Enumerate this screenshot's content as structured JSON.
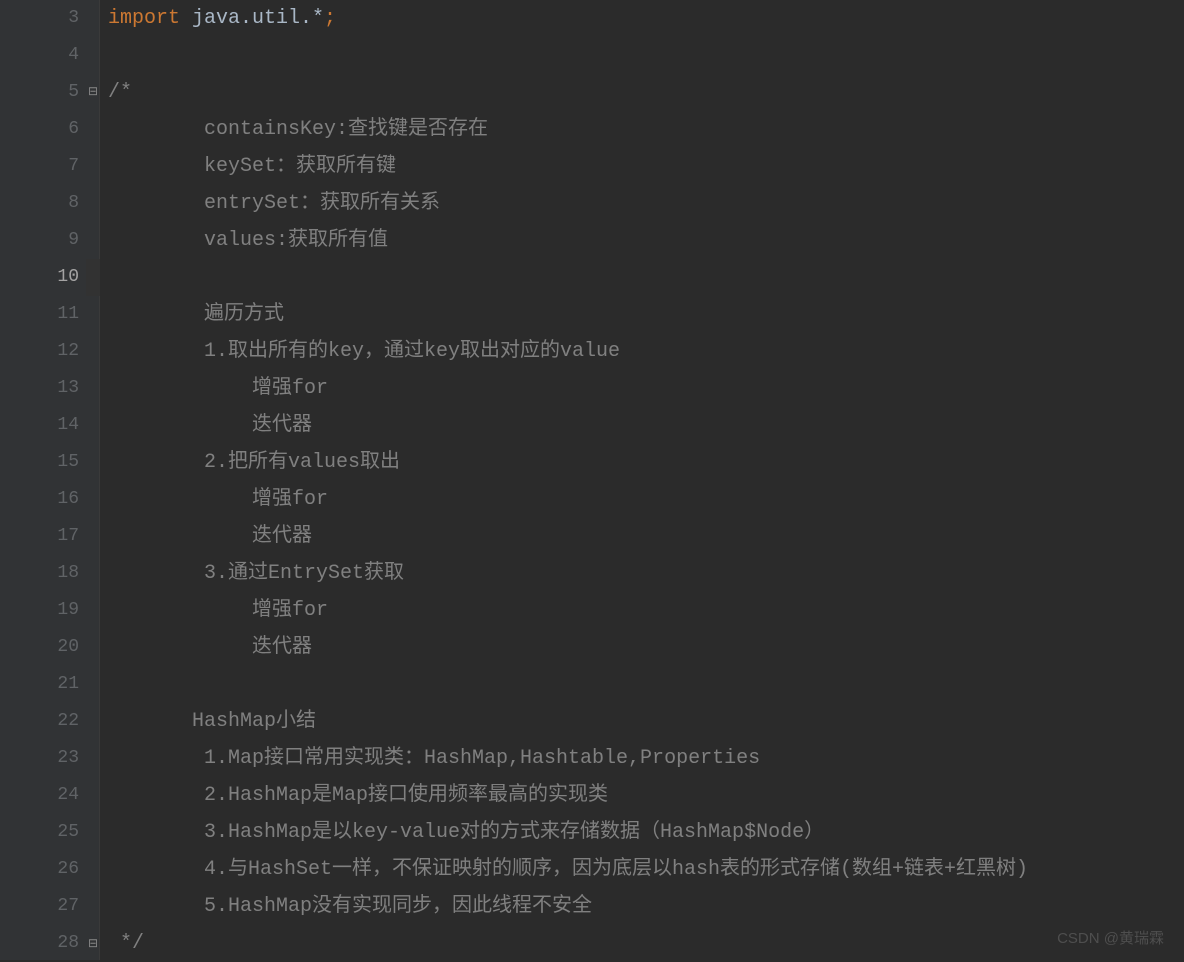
{
  "gutter": {
    "start": 3,
    "end": 28,
    "active": 10
  },
  "code": {
    "l3_import": "import",
    "l3_pkg": " java.util.*",
    "l3_semi": ";",
    "l4": "",
    "l5": "/*",
    "l6": "        containsKey:查找键是否存在",
    "l7": "        keySet：获取所有键",
    "l8": "        entrySet：获取所有关系",
    "l9": "        values:获取所有值",
    "l10": "",
    "l11": "        遍历方式",
    "l12": "        1.取出所有的key，通过key取出对应的value",
    "l13": "            增强for",
    "l14": "            迭代器",
    "l15": "        2.把所有values取出",
    "l16": "            增强for",
    "l17": "            迭代器",
    "l18": "        3.通过EntrySet获取",
    "l19": "            增强for",
    "l20": "            迭代器",
    "l21": "",
    "l22": "       HashMap小结",
    "l23": "        1.Map接口常用实现类：HashMap,Hashtable,Properties",
    "l24": "        2.HashMap是Map接口使用频率最高的实现类",
    "l25": "        3.HashMap是以key-value对的方式来存储数据（HashMap$Node）",
    "l26": "        4.与HashSet一样，不保证映射的顺序，因为底层以hash表的形式存储(数组+链表+红黑树)",
    "l27": "        5.HashMap没有实现同步，因此线程不安全",
    "l28": " */"
  },
  "watermark1": "CSDN @黄瑞霖",
  "watermark2": ""
}
